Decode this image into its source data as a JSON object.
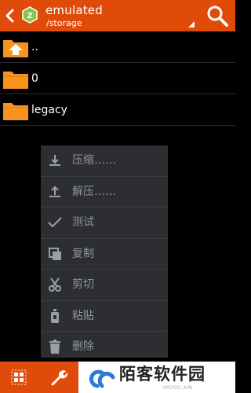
{
  "header": {
    "title": "emulated",
    "path": "/storage",
    "accent": "#e14b0a"
  },
  "files": [
    {
      "name": "..",
      "icon": "folder-up-icon"
    },
    {
      "name": "0",
      "icon": "folder-icon"
    },
    {
      "name": "legacy",
      "icon": "folder-icon"
    }
  ],
  "context_menu": {
    "items": [
      {
        "label": "压缩……",
        "icon": "download-icon"
      },
      {
        "label": "解压……",
        "icon": "upload-icon"
      },
      {
        "label": "测试",
        "icon": "check-icon"
      },
      {
        "label": "复制",
        "icon": "copy-icon"
      },
      {
        "label": "剪切",
        "icon": "scissors-icon"
      },
      {
        "label": "粘贴",
        "icon": "paste-icon"
      },
      {
        "label": "删除",
        "icon": "trash-icon"
      }
    ]
  },
  "bottom_bar": {
    "grid_icon": "grid-icon",
    "tools_icon": "wrench-icon"
  },
  "watermark": {
    "text": "陌客软件园",
    "sub": "IMOOC.XIN"
  }
}
